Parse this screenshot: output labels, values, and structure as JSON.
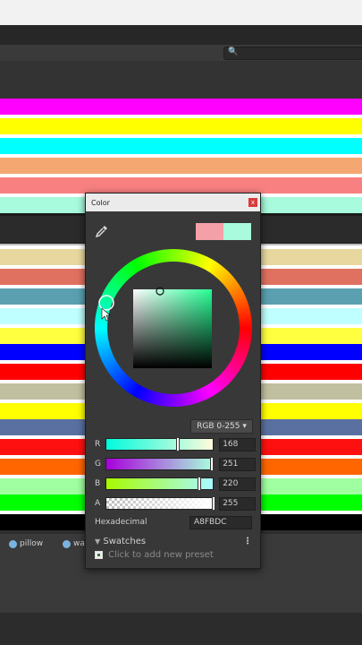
{
  "background": {
    "stripe_colors": [
      "#ff00ff",
      "#ffffff",
      "#ffff00",
      "#ffffff",
      "#00ffff",
      "#ffffff",
      "#f4a770",
      "#ffffff",
      "#f88080",
      "#ffffff",
      "#a8fbdc",
      "#1a1a1a",
      "#c0c0c0",
      "#ffffff",
      "#e8d8a0",
      "#ffffff",
      "#e07060",
      "#ffffff",
      "#5aa0b0",
      "#ffffff",
      "#c0ffff",
      "#ffffff",
      "#ffff40",
      "#0000ff",
      "#ffffff",
      "#ff0000",
      "#ffffff",
      "#c0c0a0",
      "#ffffff",
      "#ffff00",
      "#5a70a0",
      "#ffffff",
      "#ff1010",
      "#ffffff",
      "#ff6600",
      "#ffffff",
      "#a0ffa0",
      "#00ff00",
      "#ffffff",
      "#000000"
    ]
  },
  "assets": [
    {
      "label": "pillow"
    },
    {
      "label": "wal"
    }
  ],
  "color_window": {
    "title": "Color",
    "close_label": "x",
    "preview": {
      "previous": "#f4a0a8",
      "current": "#a8fbdc"
    },
    "mode_label": "RGB 0-255",
    "channels": [
      {
        "label": "R",
        "value": "168",
        "fraction": 0.659,
        "gradient": "linear-gradient(90deg,#00fbdc,#fffbdc)"
      },
      {
        "label": "G",
        "value": "251",
        "fraction": 0.984,
        "gradient": "linear-gradient(90deg,#a800dc,#a8ffdc)"
      },
      {
        "label": "B",
        "value": "220",
        "fraction": 0.863,
        "gradient": "linear-gradient(90deg,#a8fb00,#a8fbff)"
      },
      {
        "label": "A",
        "value": "255",
        "fraction": 1.0,
        "gradient": "checker"
      }
    ],
    "hex_label": "Hexadecimal",
    "hex_value": "A8FBDC",
    "swatches_label": "Swatches",
    "add_preset_label": "Click to add new preset",
    "accent": "#a8fbdc"
  }
}
